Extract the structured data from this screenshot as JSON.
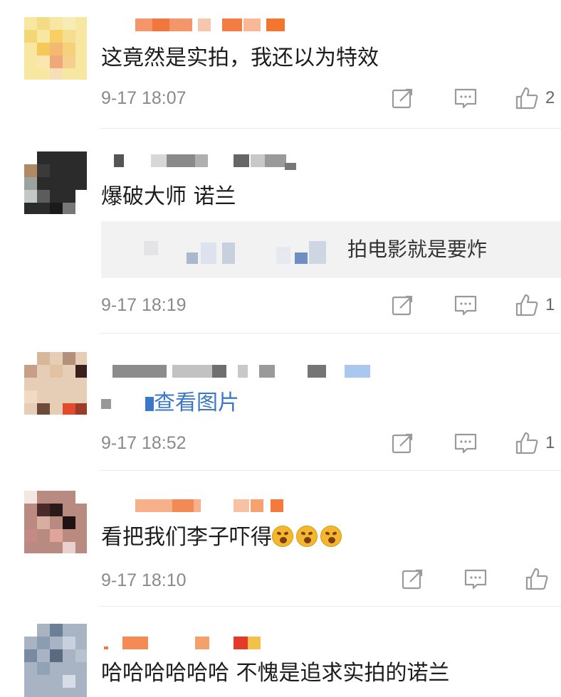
{
  "comments": [
    {
      "text": "这竟然是实拍，我还以为特效",
      "time": "9-17 18:07",
      "like_count": "2"
    },
    {
      "text": "爆破大师 诺兰",
      "quote": "拍电影就是要炸",
      "time": "9-17 18:19",
      "like_count": "1"
    },
    {
      "text_link": "查看图片",
      "time": "9-17 18:52",
      "like_count": "1"
    },
    {
      "text": "看把我们李子吓得",
      "emoji_count": 3,
      "time": "9-17 18:10",
      "like_count": ""
    },
    {
      "text": "哈哈哈哈哈哈 不愧是追求实拍的诺兰"
    }
  ],
  "icons": {
    "share": "share-icon",
    "comment": "comment-icon",
    "like": "thumbs-up-icon",
    "emoji": "frightened-face-emoji"
  },
  "colors": {
    "link": "#3b78c8",
    "time": "#8a8a8a",
    "divider": "#ececec",
    "quote_bg": "#f2f2f2"
  }
}
